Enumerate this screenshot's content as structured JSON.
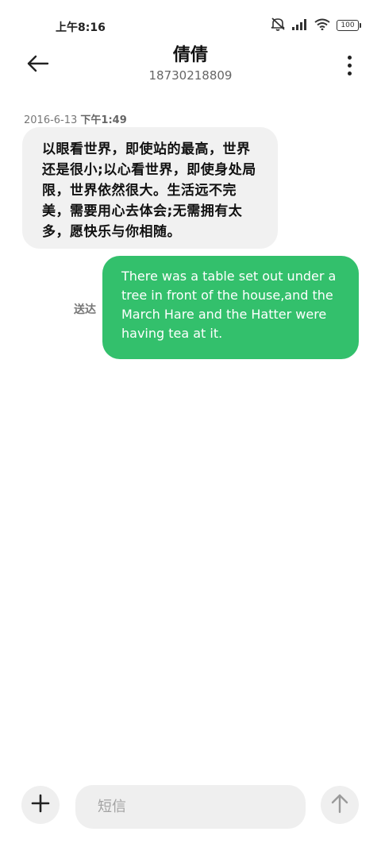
{
  "status_bar": {
    "time": "上午8:16",
    "battery_level": "100",
    "icons": [
      "mute-bell-icon",
      "signal-icon",
      "wifi-icon",
      "battery-icon"
    ]
  },
  "header": {
    "contact_name": "倩倩",
    "contact_number": "18730218809",
    "back_icon": "back-arrow-icon",
    "menu_icon": "more-vertical-icon"
  },
  "conversation": {
    "timestamp_date": "2016-6-13",
    "timestamp_time": "下午1:49",
    "messages": [
      {
        "direction": "incoming",
        "text": "以眼看世界，即使站的最高，世界还是很小;以心看世界，即使身处局限，世界依然很大。生活远不完美，需要用心去体会;无需拥有太多，愿快乐与你相随。"
      },
      {
        "direction": "outgoing",
        "status": "送达",
        "text": "There was a table set out under a tree in front of the house,and the March Hare and the Hatter were having tea at it."
      }
    ]
  },
  "composer": {
    "placeholder": "短信",
    "add_icon": "plus-icon",
    "send_icon": "send-arrow-icon"
  },
  "colors": {
    "outgoing_bubble": "#33c06c",
    "incoming_bubble": "#f1f1f1",
    "background": "#ffffff"
  }
}
